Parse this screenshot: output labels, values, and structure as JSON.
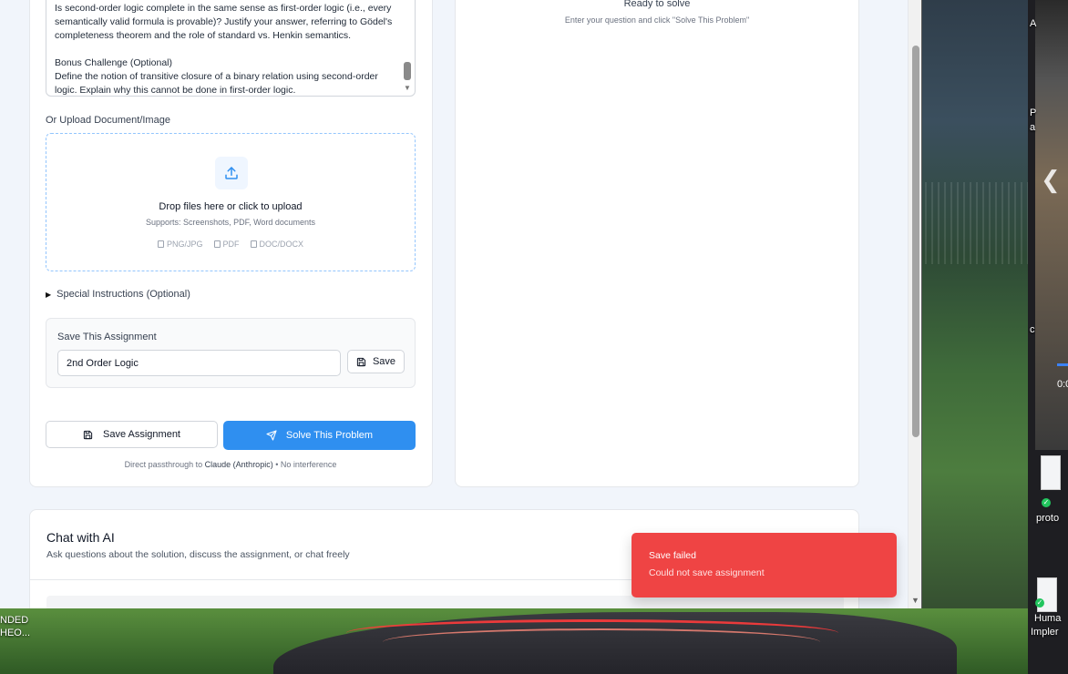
{
  "problem_text": "Is second-order logic complete in the same sense as first-order logic (i.e., every semantically valid formula is provable)? Justify your answer, referring to Gödel's completeness theorem and the role of standard vs. Henkin semantics.\n\nBonus Challenge (Optional)\nDefine the notion of transitive closure of a binary relation using second-order logic. Explain why this cannot be done in first-order logic.",
  "upload": {
    "label": "Or Upload Document/Image",
    "title": "Drop files here or click to upload",
    "subtitle": "Supports: Screenshots, PDF, Word documents",
    "formats": [
      "PNG/JPG",
      "PDF",
      "DOC/DOCX"
    ]
  },
  "special_instructions": "Special Instructions (Optional)",
  "save_box": {
    "title": "Save This Assignment",
    "name_value": "2nd Order Logic",
    "save_label": "Save"
  },
  "actions": {
    "save_assignment": "Save Assignment",
    "solve": "Solve This Problem"
  },
  "footnote": {
    "prefix": "Direct passthrough to",
    "provider": "Claude (Anthropic)",
    "suffix": "• No interference"
  },
  "result_panel": {
    "title": "Ready to solve",
    "subtitle": "Enter your question and click \"Solve This Problem\""
  },
  "chat": {
    "title": "Chat with AI",
    "subtitle": "Ask questions about the solution, discuss the assignment, or chat freely"
  },
  "toast": {
    "title": "Save failed",
    "message": "Could not save assignment",
    "color": "#ef4444"
  },
  "accent_color": "#2f8ff0",
  "desktop": {
    "left_label_1": "NDED",
    "left_label_2": "HEO...",
    "right_labels": [
      "A",
      "P",
      "a",
      "c",
      "proto",
      "Huma",
      "Impler"
    ],
    "video_time": "0:0"
  }
}
